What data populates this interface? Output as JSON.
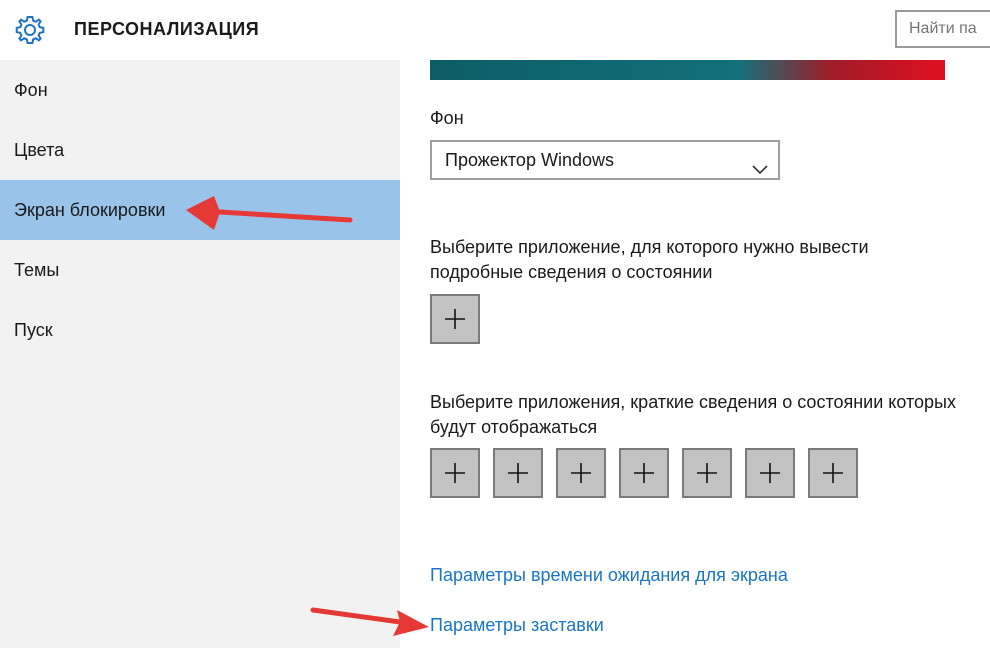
{
  "header": {
    "title": "ПЕРСОНАЛИЗАЦИЯ",
    "search_placeholder": "Найти па"
  },
  "sidebar": {
    "items": [
      {
        "label": "Фон"
      },
      {
        "label": "Цвета"
      },
      {
        "label": "Экран блокировки",
        "active": true
      },
      {
        "label": "Темы"
      },
      {
        "label": "Пуск"
      }
    ]
  },
  "main": {
    "background_label": "Фон",
    "background_value": "Прожектор Windows",
    "detailed_status_label": "Выберите приложение, для которого нужно вывести подробные сведения о состоянии",
    "quick_status_label": "Выберите приложения, краткие сведения о состоянии которых будут отображаться",
    "quick_status_slots": 7,
    "link_timeout": "Параметры времени ожидания для экрана",
    "link_screensaver": "Параметры заставки"
  },
  "colors": {
    "active_sidebar": "#99c3e9",
    "link": "#1976c4",
    "annotation_arrow": "#e53935"
  },
  "icons": [
    "gear-icon",
    "chevron-down-icon",
    "plus-icon"
  ]
}
